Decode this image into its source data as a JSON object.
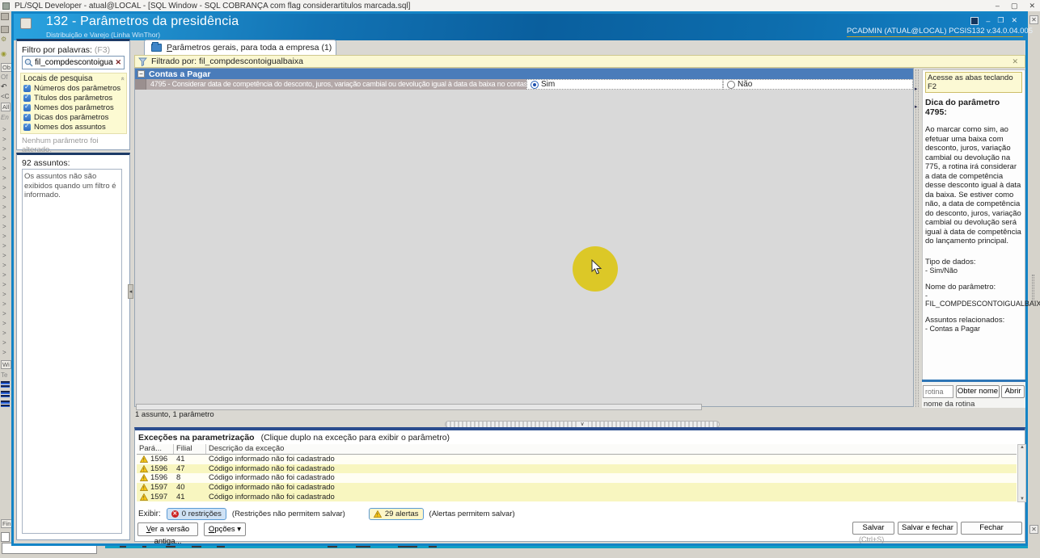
{
  "theme": {
    "window_border": "#1484c6",
    "header_blue_dark": "#0a5f9e",
    "header_blue_light": "#2aa3e0",
    "section_blue": "#4a7cba",
    "param_row_mauve": "#b3a8a8",
    "pale_yellow": "#fcf9d4",
    "row_yellow": "#f8f6c0",
    "navy_panel_border": "#1c3a66",
    "cursor_highlight": "#dcc827",
    "gold_underline": "#c9a227",
    "warning_yellow": "#f5c518",
    "restriction_red": "#cc2222"
  },
  "os_bar": {
    "title": "PL/SQL Developer - atual@LOCAL - [SQL Window - SQL COBRANÇA com flag considerartitulos marcada.sql]",
    "minimize": "‒",
    "maximize": "▢",
    "close": "✕"
  },
  "window": {
    "title": "132 - Parâmetros da presidência",
    "subtitle": "Distribuição e Varejo (Linha WinThor)",
    "user_info": "PCADMIN (ATUAL@LOCAL)   PCSIS132  v.34.0.04.005",
    "controls": {
      "minimize": "‒",
      "maximize": "❐",
      "close": "✕"
    }
  },
  "sidebar": {
    "filter_label": "Filtro por palavras:",
    "filter_hint": "(F3)",
    "search_value": "fil_compdescontoigualbaixa",
    "clear_glyph": "✕",
    "places_title": "Locais de pesquisa",
    "collapse_glyph": "«",
    "checkboxes": [
      "Números dos parâmetros",
      "Títulos dos parâmetros",
      "Nomes dos parâmetros",
      "Dicas dos parâmetros",
      "Nomes dos assuntos"
    ],
    "no_change_text": "Nenhum parâmetro foi alterado.",
    "subjects_count": "92 assuntos:",
    "subjects_note": "Os assuntos não são exibidos quando um filtro é informado.",
    "collapse_arrow": "◂"
  },
  "main": {
    "tab_label": "Parâmetros gerais, para toda a empresa  (1)",
    "filter_bar_text": "Filtrado por: fil_compdescontoigualbaixa",
    "filter_pin_glyph": "✕",
    "section_collapse_glyph": "−",
    "section_title": "Contas a Pagar",
    "parameter_text": "4795 - Considerar data de competência do desconto, juros, variação cambial ou devolução igual à data da baixa no contas a pagar",
    "option_yes": "Sim",
    "option_no": "Não",
    "selected_option": "Sim",
    "status_line": "1 assunto, 1 parâmetro",
    "splitter_glyph": "∨",
    "vsplit_glyph": "▸"
  },
  "hint_panel": {
    "f2_tip": "Acesse as abas teclando F2",
    "title": "Dica do parâmetro 4795:",
    "body": "Ao marcar como sim, ao efetuar uma baixa com desconto, juros, variação cambial ou devolução na 775, a rotina irá considerar a data de competência desse desconto igual à data da baixa. Se estiver como não, a data de competência do desconto, juros, variação cambial ou devolução será igual à data de competência do lançamento principal.",
    "datatype_label": "Tipo de dados:",
    "datatype_value": "- Sim/Não",
    "param_name_label": "Nome do parâmetro:",
    "param_name_value": "- FIL_COMPDESCONTOIGUALBAIXA",
    "related_label": "Assuntos relacionados:",
    "related_value": "- Contas a Pagar",
    "routine_placeholder": "rotina",
    "get_name_button": "Obter nome",
    "open_button": "Abrir",
    "routine_name_text": "nome da rotina"
  },
  "exceptions": {
    "title": "Exceções na parametrização",
    "subtitle": "(Clique duplo na exceção para exibir o parâmetro)",
    "columns": {
      "param": "Pará...",
      "filial": "Filial",
      "desc": "Descrição da exceção"
    },
    "rows": [
      {
        "param": "1596",
        "filial": "41",
        "desc": "Código informado não foi cadastrado"
      },
      {
        "param": "1596",
        "filial": "47",
        "desc": "Código informado não foi cadastrado"
      },
      {
        "param": "1596",
        "filial": "8",
        "desc": "Código informado não foi cadastrado"
      },
      {
        "param": "1597",
        "filial": "40",
        "desc": "Código informado não foi cadastrado"
      },
      {
        "param": "1597",
        "filial": "41",
        "desc": "Código informado não foi cadastrado"
      }
    ],
    "show_label": "Exibir:",
    "restrictions_badge": "0 restrições",
    "restrictions_note": "(Restrições não permitem salvar)",
    "alerts_badge": "29 alertas",
    "alerts_note": "(Alertas permitem salvar)"
  },
  "footer": {
    "old_version_button": "Ver a versão antiga...",
    "options_button": "Opções ▾",
    "save_button": "Salvar",
    "save_shortcut": "(Ctrl+S)",
    "save_close_button": "Salvar e fechar",
    "close_button": "Fechar"
  },
  "left_strip": {
    "ob": "Ob",
    "of": "Of",
    "undo_glyph": "↶",
    "c": "<C",
    "all": "All",
    "en": "En",
    "wi": "Wi",
    "te": "Te",
    "fin": "Fin",
    "tree_chevron_char": ">",
    "tree_chevron_count": 24
  },
  "right_strip": {
    "close_glyph": "✕"
  }
}
